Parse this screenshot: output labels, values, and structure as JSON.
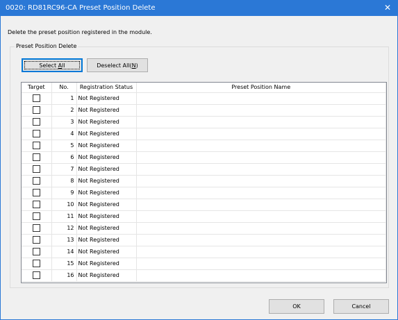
{
  "window": {
    "title": "0020: RD81RC96-CA Preset Position Delete",
    "close_glyph": "✕"
  },
  "description": "Delete the preset position registered in the module.",
  "group": {
    "label": "Preset Position Delete",
    "select_all_prefix": "Select ",
    "select_all_mnemonic": "A",
    "select_all_suffix": "ll",
    "deselect_all_prefix": "Deselect All(",
    "deselect_all_mnemonic": "N",
    "deselect_all_suffix": ")"
  },
  "table": {
    "headers": [
      "Target",
      "No.",
      "Registration Status",
      "Preset Position Name"
    ],
    "rows": [
      {
        "checked": false,
        "no": "1",
        "status": "Not Registered",
        "name": ""
      },
      {
        "checked": false,
        "no": "2",
        "status": "Not Registered",
        "name": ""
      },
      {
        "checked": false,
        "no": "3",
        "status": "Not Registered",
        "name": ""
      },
      {
        "checked": false,
        "no": "4",
        "status": "Not Registered",
        "name": ""
      },
      {
        "checked": false,
        "no": "5",
        "status": "Not Registered",
        "name": ""
      },
      {
        "checked": false,
        "no": "6",
        "status": "Not Registered",
        "name": ""
      },
      {
        "checked": false,
        "no": "7",
        "status": "Not Registered",
        "name": ""
      },
      {
        "checked": false,
        "no": "8",
        "status": "Not Registered",
        "name": ""
      },
      {
        "checked": false,
        "no": "9",
        "status": "Not Registered",
        "name": ""
      },
      {
        "checked": false,
        "no": "10",
        "status": "Not Registered",
        "name": ""
      },
      {
        "checked": false,
        "no": "11",
        "status": "Not Registered",
        "name": ""
      },
      {
        "checked": false,
        "no": "12",
        "status": "Not Registered",
        "name": ""
      },
      {
        "checked": false,
        "no": "13",
        "status": "Not Registered",
        "name": ""
      },
      {
        "checked": false,
        "no": "14",
        "status": "Not Registered",
        "name": ""
      },
      {
        "checked": false,
        "no": "15",
        "status": "Not Registered",
        "name": ""
      },
      {
        "checked": false,
        "no": "16",
        "status": "Not Registered",
        "name": ""
      }
    ]
  },
  "footer": {
    "ok_label": "OK",
    "cancel_label": "Cancel"
  },
  "colors": {
    "titlebar": "#2b78d6",
    "dialog_background": "#f0f0f0",
    "button_face": "#e1e1e1",
    "focus_border": "#0078d7"
  }
}
